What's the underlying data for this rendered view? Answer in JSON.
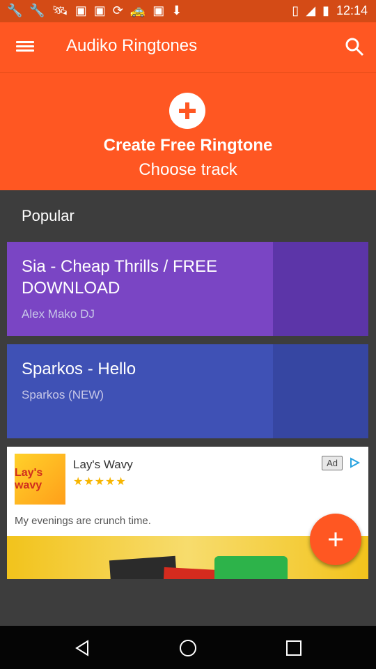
{
  "status_bar": {
    "time": "12:14",
    "left_icons": [
      "wrench-icon",
      "wrench-icon",
      "satellite-icon",
      "image-icon",
      "image-icon",
      "sync-icon",
      "taxi-icon",
      "image-icon",
      "download-icon"
    ],
    "right_icons": [
      "vibrate-icon",
      "signal-icon",
      "battery-icon"
    ]
  },
  "app_bar": {
    "title": "Audiko Ringtones"
  },
  "hero": {
    "title": "Create Free Ringtone",
    "subtitle": "Choose track"
  },
  "section": {
    "popular_label": "Popular"
  },
  "tracks": [
    {
      "title": "Sia - Cheap Thrills  / FREE DOWNLOAD",
      "artist": "Alex Mako DJ"
    },
    {
      "title": "Sparkos - Hello",
      "artist": "Sparkos (NEW)"
    }
  ],
  "ad": {
    "logo_text": "Lay's wavy",
    "brand": "Lay's Wavy",
    "rating_stars": 5,
    "stars_text": "★★★★★",
    "badge": "Ad",
    "tagline": "My evenings are crunch time."
  },
  "colors": {
    "primary": "#ff5722",
    "status_bar": "#d44b16",
    "card1": "#7a45c4",
    "card2": "#3f51b5",
    "background": "#3d3d3d"
  }
}
